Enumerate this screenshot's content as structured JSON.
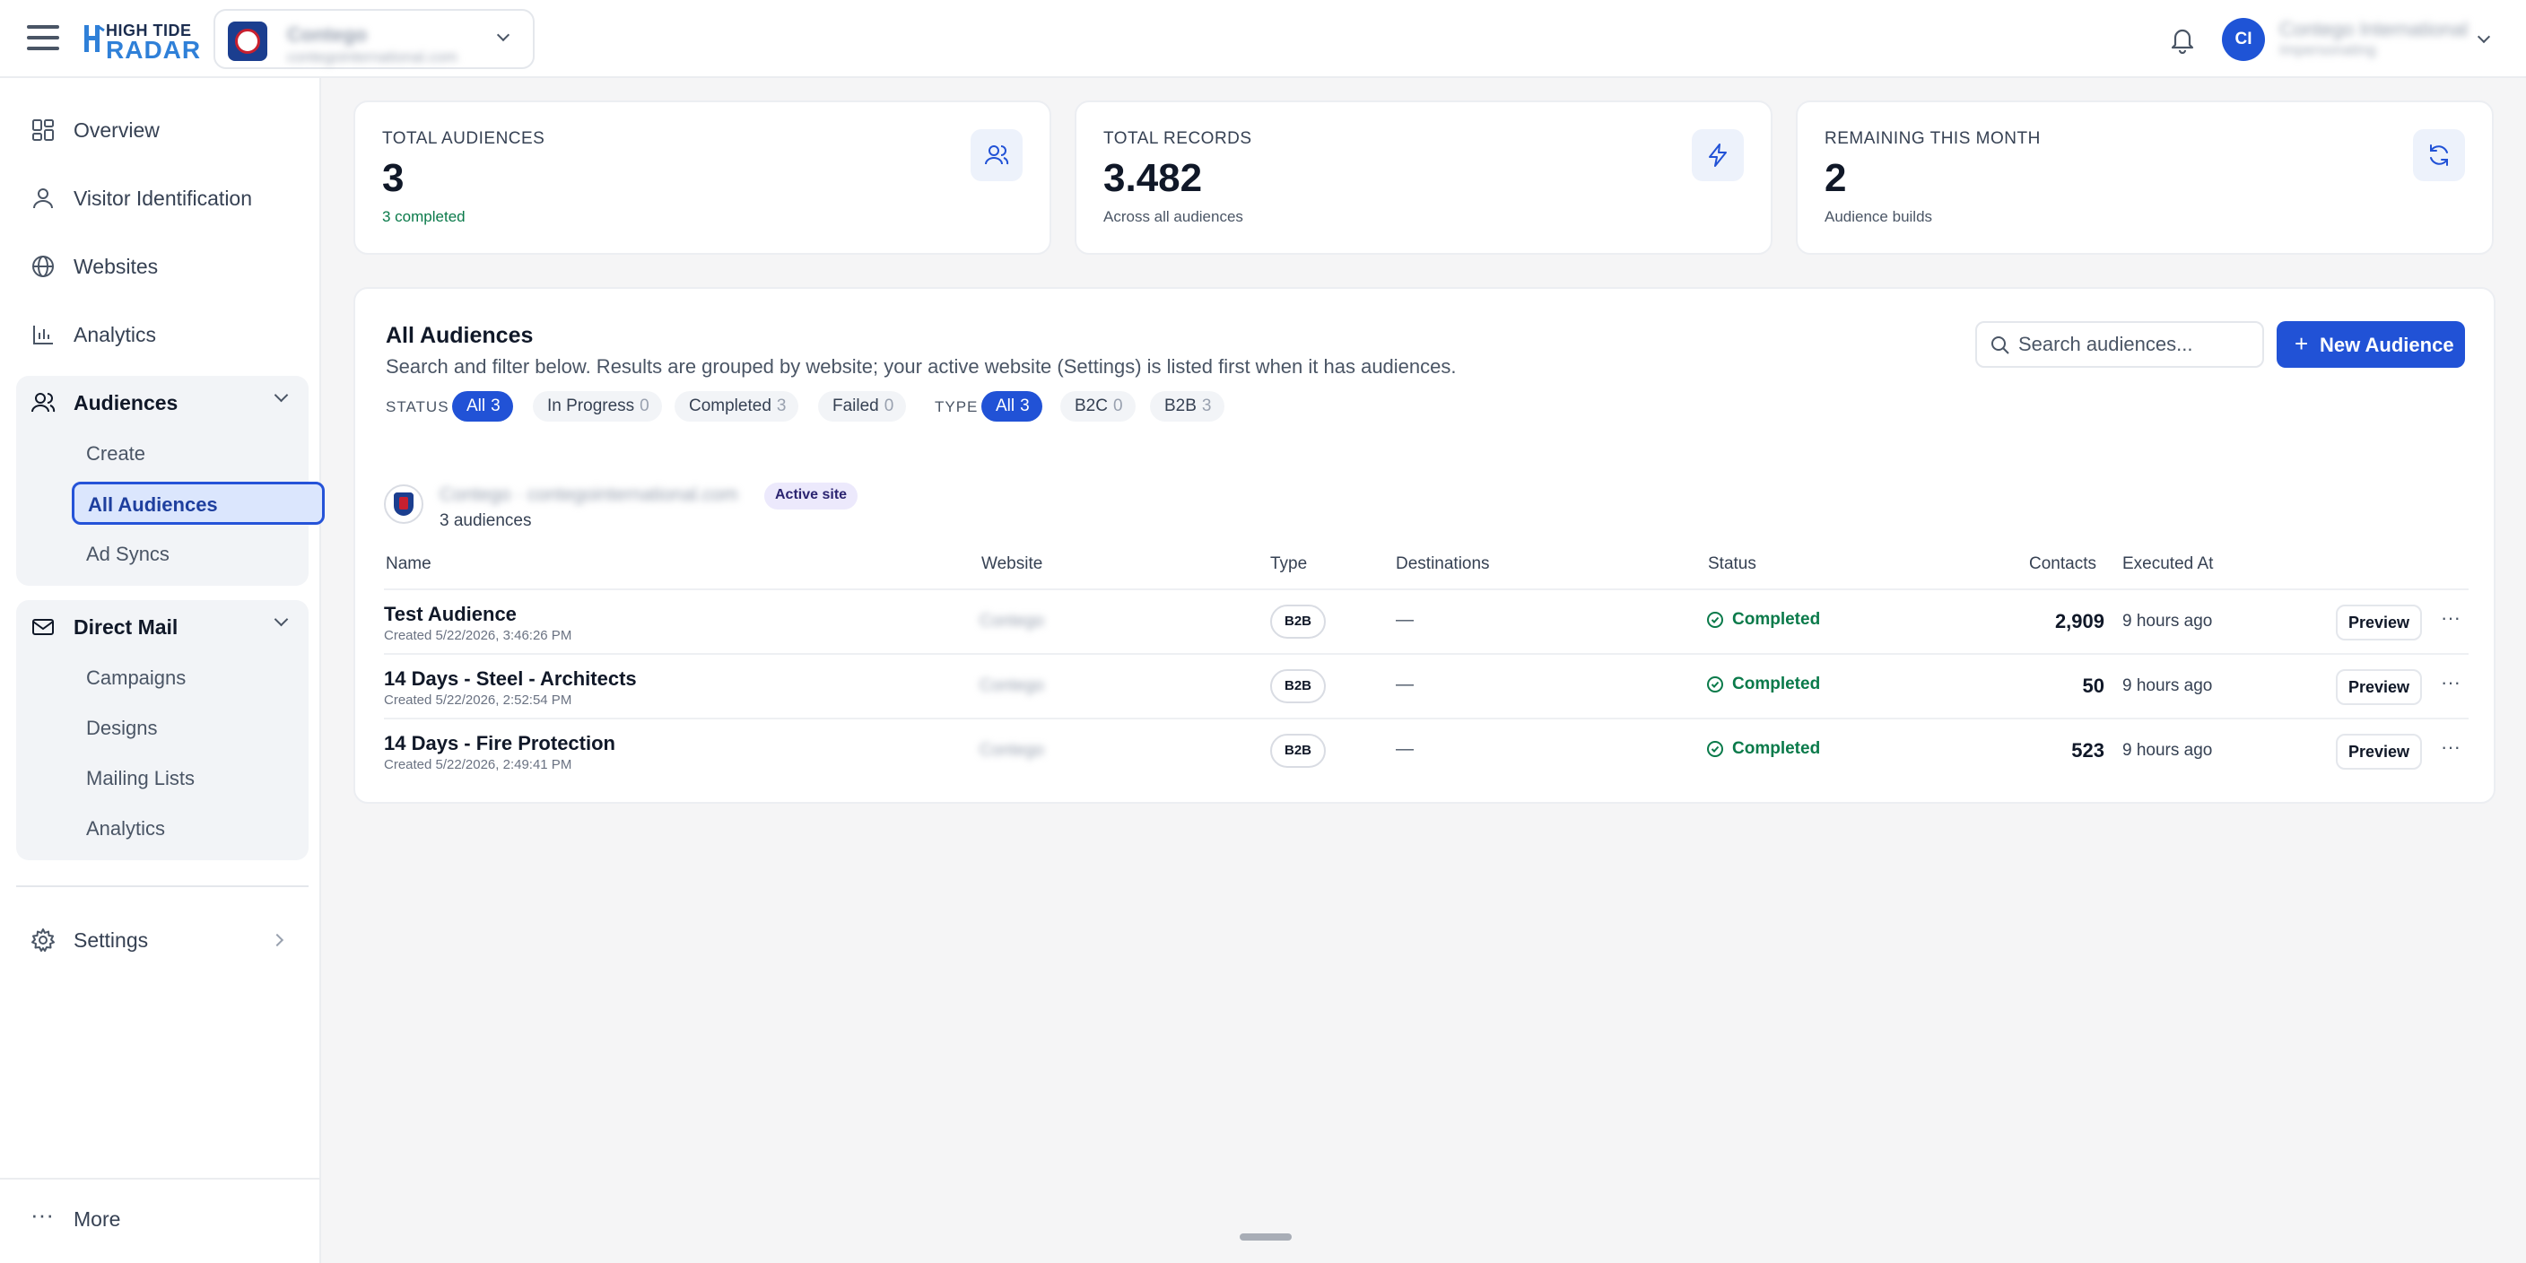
{
  "topbar": {
    "logo_line1": "HIGH TIDE",
    "logo_line2": "RADAR",
    "site_name": "Contego",
    "site_url": "contegointernational.com",
    "account_initials": "CI",
    "account_name": "Contego International",
    "account_role": "Impersonating"
  },
  "sidebar": {
    "overview": "Overview",
    "visitor_identification": "Visitor Identification",
    "websites": "Websites",
    "analytics": "Analytics",
    "audiences": {
      "label": "Audiences",
      "items": [
        "Create",
        "All Audiences",
        "Ad Syncs"
      ],
      "active": "All Audiences"
    },
    "direct_mail": {
      "label": "Direct Mail",
      "items": [
        "Campaigns",
        "Designs",
        "Mailing Lists",
        "Analytics"
      ]
    },
    "settings": "Settings",
    "more": "More"
  },
  "stats": [
    {
      "label": "TOTAL AUDIENCES",
      "value": "3",
      "sub": "3 completed",
      "icon": "users-icon"
    },
    {
      "label": "TOTAL RECORDS",
      "value": "3.482",
      "sub": "Across all audiences",
      "icon": "lightning-icon"
    },
    {
      "label": "REMAINING THIS MONTH",
      "value": "2",
      "sub": "Audience builds",
      "icon": "refresh-icon"
    }
  ],
  "panel": {
    "title": "All Audiences",
    "description": "Search and filter below. Results are grouped by website; your active website (Settings) is listed first when it has audiences.",
    "search_placeholder": "Search audiences...",
    "new_button": "New Audience",
    "status_label": "STATUS",
    "type_label": "TYPE",
    "status_filters": [
      {
        "label": "All",
        "count": "3",
        "selected": true
      },
      {
        "label": "In Progress",
        "count": "0",
        "selected": false
      },
      {
        "label": "Completed",
        "count": "3",
        "selected": false
      },
      {
        "label": "Failed",
        "count": "0",
        "selected": false
      }
    ],
    "type_filters": [
      {
        "label": "All",
        "count": "3",
        "selected": true
      },
      {
        "label": "B2C",
        "count": "0",
        "selected": false
      },
      {
        "label": "B2B",
        "count": "3",
        "selected": false
      }
    ],
    "group": {
      "name": "Contego · contegointernational.com",
      "badge": "Active site",
      "count": "3 audiences"
    },
    "columns": [
      "Name",
      "Website",
      "Type",
      "Destinations",
      "Status",
      "Contacts",
      "Executed At"
    ],
    "rows": [
      {
        "name": "Test Audience",
        "created": "Created 5/22/2026, 3:46:26 PM",
        "website": "Contego",
        "type": "B2B",
        "destinations": "—",
        "status": "Completed",
        "contacts": "2,909",
        "executed": "9 hours ago",
        "action": "Preview"
      },
      {
        "name": "14 Days - Steel - Architects",
        "created": "Created 5/22/2026, 2:52:54 PM",
        "website": "Contego",
        "type": "B2B",
        "destinations": "—",
        "status": "Completed",
        "contacts": "50",
        "executed": "9 hours ago",
        "action": "Preview"
      },
      {
        "name": "14 Days - Fire Protection",
        "created": "Created 5/22/2026, 2:49:41 PM",
        "website": "Contego",
        "type": "B2B",
        "destinations": "—",
        "status": "Completed",
        "contacts": "523",
        "executed": "9 hours ago",
        "action": "Preview"
      }
    ],
    "more_glyph": "···"
  },
  "colors": {
    "accent": "#2152d6",
    "success": "#0a7a4a",
    "active_site_badge": "#ece9fc"
  }
}
